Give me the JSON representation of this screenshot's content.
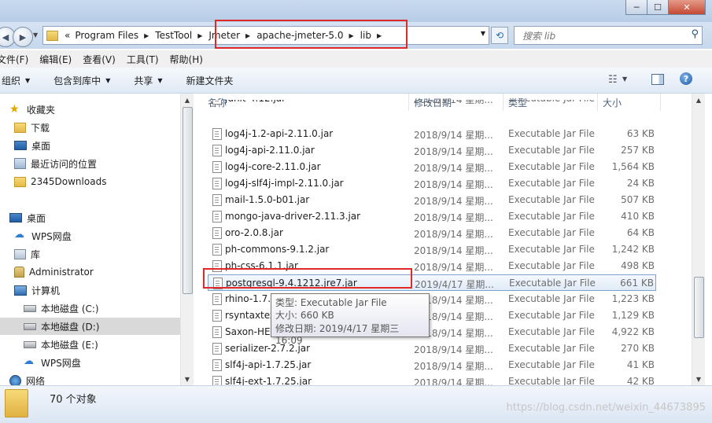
{
  "window": {
    "min_glyph": "─",
    "max_glyph": "☐",
    "close_glyph": "✕"
  },
  "address": {
    "crumbs": [
      "Program Files",
      "TestTool",
      "Jmeter",
      "apache-jmeter-5.0",
      "lib"
    ],
    "overflow": "«",
    "search_placeholder": "搜索 lib"
  },
  "menu": [
    "文件(F)",
    "编辑(E)",
    "查看(V)",
    "工具(T)",
    "帮助(H)"
  ],
  "toolbar": {
    "organize": "组织",
    "include_in_library": "包含到库中",
    "share": "共享",
    "new_folder": "新建文件夹"
  },
  "nav": {
    "favorites": "收藏夹",
    "downloads": "下载",
    "desktop_fav": "桌面",
    "recent": "最近访问的位置",
    "downloads2345": "2345Downloads",
    "desktop": "桌面",
    "wps_cloud": "WPS网盘",
    "libraries": "库",
    "administrator": "Administrator",
    "computer": "计算机",
    "drive_c": "本地磁盘 (C:)",
    "drive_d": "本地磁盘 (D:)",
    "drive_e": "本地磁盘 (E:)",
    "wps_cloud2": "WPS网盘",
    "network": "网络"
  },
  "columns": {
    "name": "名称",
    "date": "修改日期",
    "type": "类型",
    "size": "大小"
  },
  "files": [
    {
      "name": "junit-4.12.jar",
      "date": "2018/9/14 星期...",
      "type": "Executable Jar File",
      "size": ""
    },
    {
      "name": "log4j-1.2-api-2.11.0.jar",
      "date": "2018/9/14 星期...",
      "type": "Executable Jar File",
      "size": "63 KB"
    },
    {
      "name": "log4j-api-2.11.0.jar",
      "date": "2018/9/14 星期...",
      "type": "Executable Jar File",
      "size": "257 KB"
    },
    {
      "name": "log4j-core-2.11.0.jar",
      "date": "2018/9/14 星期...",
      "type": "Executable Jar File",
      "size": "1,564 KB"
    },
    {
      "name": "log4j-slf4j-impl-2.11.0.jar",
      "date": "2018/9/14 星期...",
      "type": "Executable Jar File",
      "size": "24 KB"
    },
    {
      "name": "mail-1.5.0-b01.jar",
      "date": "2018/9/14 星期...",
      "type": "Executable Jar File",
      "size": "507 KB"
    },
    {
      "name": "mongo-java-driver-2.11.3.jar",
      "date": "2018/9/14 星期...",
      "type": "Executable Jar File",
      "size": "410 KB"
    },
    {
      "name": "oro-2.0.8.jar",
      "date": "2018/9/14 星期...",
      "type": "Executable Jar File",
      "size": "64 KB"
    },
    {
      "name": "ph-commons-9.1.2.jar",
      "date": "2018/9/14 星期...",
      "type": "Executable Jar File",
      "size": "1,242 KB"
    },
    {
      "name": "ph-css-6.1.1.jar",
      "date": "2018/9/14 星期...",
      "type": "Executable Jar File",
      "size": "498 KB"
    },
    {
      "name": "postgresql-9.4.1212.jre7.jar",
      "date": "2019/4/17 星期...",
      "type": "Executable Jar File",
      "size": "661 KB"
    },
    {
      "name": "rhino-1.7.10.jar",
      "date": "2018/9/14 星期...",
      "type": "Executable Jar File",
      "size": "1,223 KB"
    },
    {
      "name": "rsyntaxtextarea-2.6.1.jar",
      "date": "2018/9/14 星期...",
      "type": "Executable Jar File",
      "size": "1,129 KB"
    },
    {
      "name": "Saxon-HE-9.8.0-12.jar",
      "date": "2018/9/14 星期...",
      "type": "Executable Jar File",
      "size": "4,922 KB"
    },
    {
      "name": "serializer-2.7.2.jar",
      "date": "2018/9/14 星期...",
      "type": "Executable Jar File",
      "size": "270 KB"
    },
    {
      "name": "slf4j-api-1.7.25.jar",
      "date": "2018/9/14 星期...",
      "type": "Executable Jar File",
      "size": "41 KB"
    },
    {
      "name": "slf4j-ext-1.7.25.jar",
      "date": "2018/9/14 星期...",
      "type": "Executable Jar File",
      "size": "42 KB"
    }
  ],
  "tooltip": {
    "type": "类型: Executable Jar File",
    "size": "大小: 660 KB",
    "modified": "修改日期: 2019/4/17 星期三 16:09"
  },
  "status": {
    "count": "70 个对象"
  },
  "watermark": "https://blog.csdn.net/weixin_44673895",
  "colors": {
    "highlight_red": "#e02a2a",
    "selection_blue": "#7da2ce"
  }
}
